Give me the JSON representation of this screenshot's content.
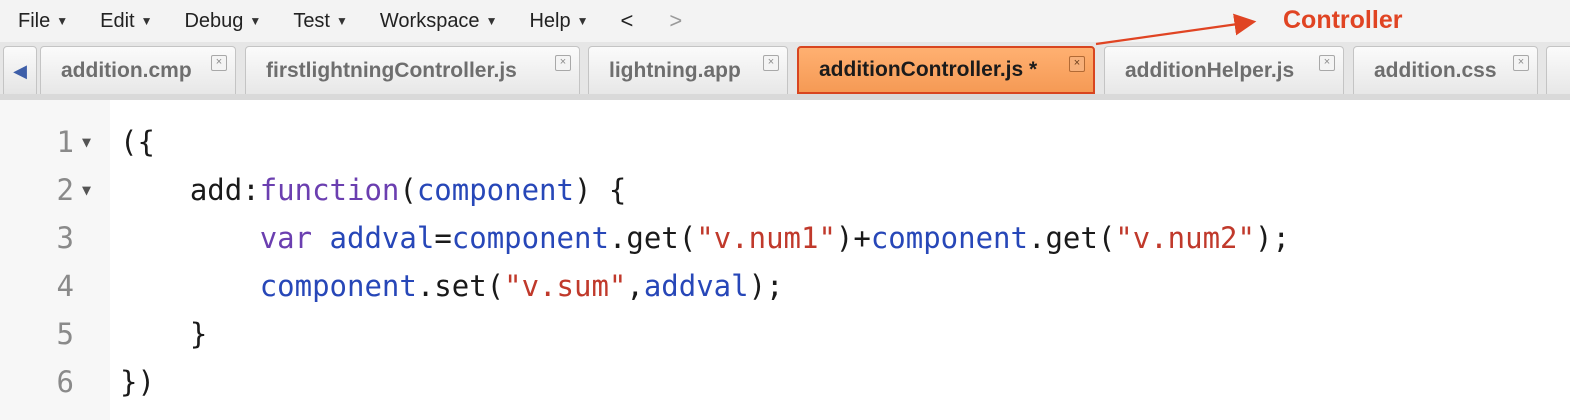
{
  "menu": {
    "items": [
      {
        "label": "File"
      },
      {
        "label": "Edit"
      },
      {
        "label": "Debug"
      },
      {
        "label": "Test"
      },
      {
        "label": "Workspace"
      },
      {
        "label": "Help"
      }
    ],
    "back": "<",
    "forward": ">"
  },
  "tabs": [
    {
      "label": "addition.cmp",
      "active": false
    },
    {
      "label": "firstlightningController.js",
      "active": false
    },
    {
      "label": "lightning.app",
      "active": false
    },
    {
      "label": "additionController.js *",
      "active": true
    },
    {
      "label": "additionHelper.js",
      "active": false
    },
    {
      "label": "addition.css",
      "active": false
    }
  ],
  "tab_close_glyph": "×",
  "tab_scroll_glyph": "◀",
  "annotation": {
    "label": "Controller",
    "color": "#e04423"
  },
  "editor": {
    "lines": [
      {
        "number": "1",
        "foldable": true
      },
      {
        "number": "2",
        "foldable": true
      },
      {
        "number": "3",
        "foldable": false
      },
      {
        "number": "4",
        "foldable": false
      },
      {
        "number": "5",
        "foldable": false
      },
      {
        "number": "6",
        "foldable": false
      }
    ],
    "code": {
      "l1": {
        "a": "({"
      },
      "l2": {
        "indent": "    ",
        "a": "add:",
        "b": "function",
        "c": "(",
        "d": "component",
        "e": ") {"
      },
      "l3": {
        "indent": "        ",
        "a": "var",
        "b": " ",
        "c": "addval",
        "d": "=",
        "e": "component",
        "f": ".get(",
        "g": "\"v.num1\"",
        "h": ")+",
        "i": "component",
        "j": ".get(",
        "k": "\"v.num2\"",
        "l": ");"
      },
      "l4": {
        "indent": "        ",
        "a": "component",
        "b": ".set(",
        "c": "\"v.sum\"",
        "d": ",",
        "e": "addval",
        "f": ");"
      },
      "l5": {
        "indent": "    ",
        "a": "}"
      },
      "l6": {
        "a": "})"
      }
    },
    "colors": {
      "keyword": "#6b3fb0",
      "identifier": "#2747b8",
      "string": "#c0392b"
    }
  }
}
